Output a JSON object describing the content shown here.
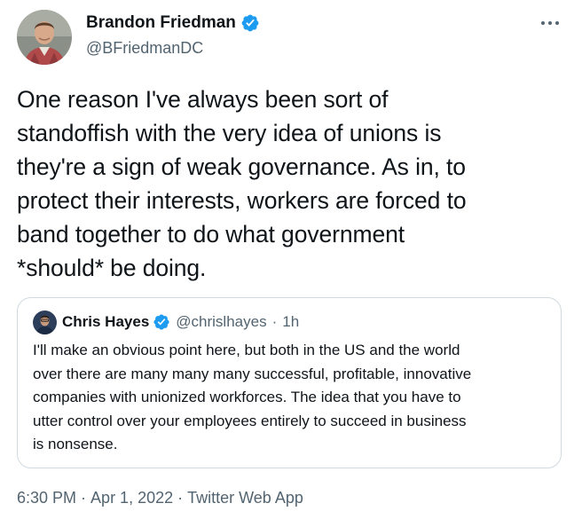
{
  "tweet": {
    "author": {
      "name": "Brandon Friedman",
      "handle": "@BFriedmanDC",
      "verified": true
    },
    "more_icon": "ellipsis-icon",
    "text": "One reason I've always been sort of\nstandoffish with the very idea of unions is\nthey're a sign of weak governance. As in, to\nprotect their interests, workers are forced to\nband together to do what government\n*should* be doing.",
    "quote": {
      "author": {
        "name": "Chris Hayes",
        "handle": "@chrislhayes",
        "verified": true
      },
      "separator": "·",
      "time": "1h",
      "text": "I'll make an obvious point here, but both in the US and the world\nover there are many many many successful, profitable, innovative\ncompanies with unionized workforces. The idea that you have to\nutter control over your employees entirely to succeed in business\nis nonsense."
    },
    "time": "6:30 PM",
    "separator": "·",
    "date": "Apr 1, 2022",
    "source": "Twitter Web App"
  },
  "colors": {
    "text": "#0f1419",
    "secondary": "#536471",
    "verified": "#1d9bf0",
    "border": "#cfd9de"
  }
}
